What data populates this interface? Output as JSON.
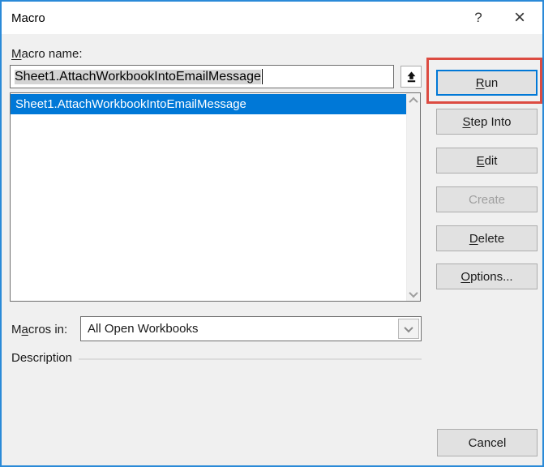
{
  "window": {
    "title": "Macro",
    "help_icon": "?",
    "close_icon": "×"
  },
  "macro_name": {
    "label_key": "M",
    "label_rest": "acro name:",
    "value": "Sheet1.AttachWorkbookIntoEmailMessage"
  },
  "macro_list": {
    "items": [
      {
        "name": "Sheet1.AttachWorkbookIntoEmailMessage",
        "selected": true
      }
    ]
  },
  "buttons": {
    "run": {
      "key": "R",
      "rest": "un"
    },
    "step_into": {
      "key": "S",
      "rest": "tep Into"
    },
    "edit": {
      "key": "E",
      "rest": "dit"
    },
    "create": {
      "label": "Create",
      "disabled": true
    },
    "delete": {
      "key": "D",
      "rest": "elete"
    },
    "options": {
      "key": "O",
      "rest": "ptions..."
    },
    "cancel": {
      "label": "Cancel"
    }
  },
  "macros_in": {
    "label_pre": "M",
    "label_key": "a",
    "label_rest": "cros in:",
    "selected_option": "All Open Workbooks"
  },
  "description": {
    "label": "Description"
  },
  "icons": {
    "submit_macro": "up-arrow-from-bar",
    "scroll_up": "chevron-up",
    "scroll_down": "chevron-down",
    "combo": "chevron-down"
  },
  "colors": {
    "window_border": "#2a8ad8",
    "selection_blue": "#0078d7",
    "default_button_border": "#0078d7",
    "annotation_red": "#dc4b41",
    "dialog_background": "#f0f0f0",
    "titlebar_background": "#ffffff"
  }
}
